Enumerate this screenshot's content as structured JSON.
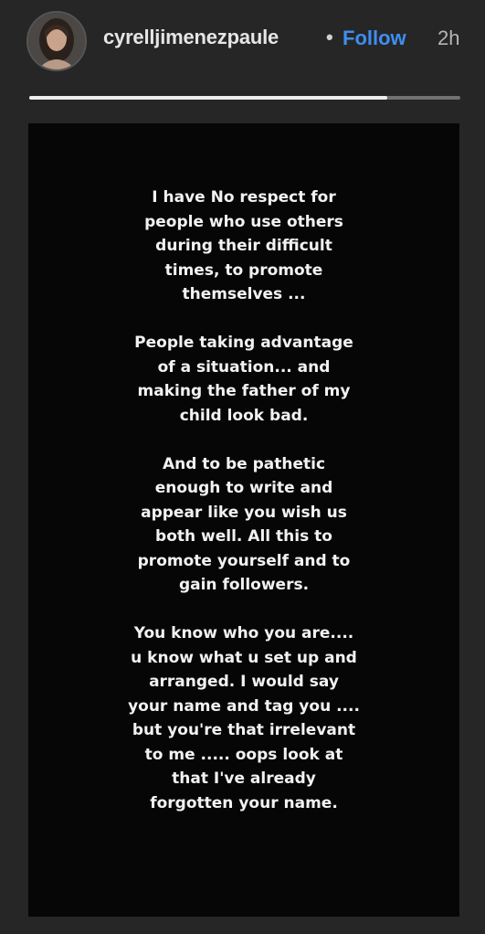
{
  "header": {
    "username": "cyrelljimenezpaule",
    "separator": "•",
    "follow_label": "Follow",
    "time_ago": "2h",
    "avatar_icon": "profile-photo"
  },
  "progress": {
    "value": 0.83,
    "fill_color": "#eeeeee"
  },
  "story": {
    "paragraphs": [
      [
        "I have No respect for",
        "people who use others",
        "during their difficult",
        "times, to promote",
        "themselves ..."
      ],
      [
        "People taking advantage",
        "of a situation... and",
        "making the father of my",
        "child look bad."
      ],
      [
        "And to be pathetic",
        "enough to write and",
        "appear like you wish us",
        "both well.  All this to",
        "promote yourself and to",
        "gain followers."
      ],
      [
        "You know who you are....",
        "u know what u set up and",
        "arranged. I would say",
        "your name and tag you ....",
        "but you're that irrelevant",
        "to me  ..... oops look at",
        "that I've already",
        "forgotten your name."
      ]
    ]
  },
  "colors": {
    "accent": "#3e8ef2",
    "background": "#262626",
    "story_background": "#060606"
  }
}
